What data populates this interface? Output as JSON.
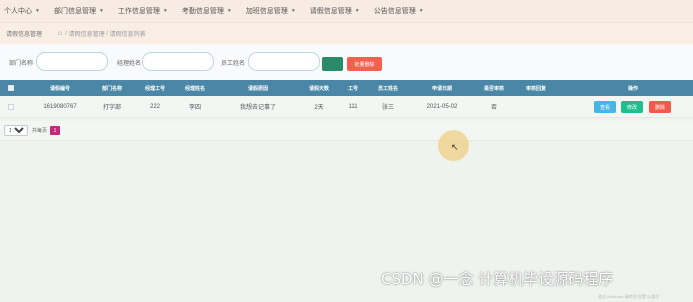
{
  "nav": {
    "items": [
      "个人中心",
      "部门信息管理",
      "工作信息管理",
      "考勤信息管理",
      "加班信息管理",
      "请假信息管理",
      "公告信息管理"
    ]
  },
  "subheader": {
    "title": "请假信息管理",
    "breadcrumb": [
      "请假信息管理",
      "请假信息列表"
    ]
  },
  "search": {
    "dept_label": "部门名称",
    "manager_label": "经理姓名",
    "employee_label": "员工姓名",
    "dept_value": "",
    "manager_value": "",
    "employee_value": "",
    "bulk_delete_label": "批量删除"
  },
  "table": {
    "headers": [
      "请假编号",
      "部门名称",
      "经理工号",
      "经理姓名",
      "请假原因",
      "请假天数",
      "工号",
      "员工姓名",
      "申请日期",
      "是否审核",
      "审核回复",
      "操作"
    ],
    "rows": [
      {
        "id": "1619080767",
        "dept": "打字部",
        "manager_no": "222",
        "manager_name": "李四",
        "reason": "我想去记事了",
        "days": "2天",
        "emp_no": "111",
        "emp_name": "张三",
        "date": "2021-05-02",
        "approved": "否",
        "reply": "",
        "actions": {
          "view": "查看",
          "edit": "修改",
          "delete": "删除"
        }
      }
    ]
  },
  "pager": {
    "page_size": "10",
    "total_text": "共每页",
    "current_page": "1"
  },
  "watermark": {
    "main": "CSDN @一念 计算机毕设源码程序",
    "small": "激活 Windows 请转到\"设置\"以激活"
  },
  "colors": {
    "nav_bg": "#f6ece1",
    "table_header": "#4a87a6",
    "view_btn": "#49b4e6",
    "edit_btn": "#1fbe8f",
    "delete_btn": "#f25a4a",
    "bulk_delete_btn": "#f1614e",
    "search_btn": "#2a8a6a",
    "page_active": "#c7287a"
  }
}
